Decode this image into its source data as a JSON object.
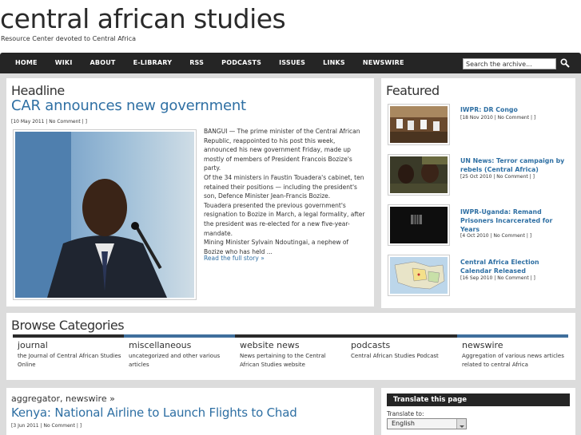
{
  "site": {
    "title": "central african studies",
    "tagline": "Resource Center devoted to Central Africa"
  },
  "nav": {
    "items": [
      "HOME",
      "WIKI",
      "ABOUT",
      "E-LIBRARY",
      "RSS",
      "PODCASTS",
      "ISSUES",
      "LINKS",
      "NEWSWIRE"
    ]
  },
  "search": {
    "placeholder": "Search the archive..."
  },
  "headline": {
    "section_label": "Headline",
    "title": "CAR announces new government",
    "meta": "[10 May 2011 | No Comment | ]",
    "body": [
      "BANGUI — The prime minister of the Central African Republic, reappointed to his post this week, announced his new government Friday, made up mostly of members of President Francois Bozize's party.",
      "Of the 34 ministers in Faustin Touadera's cabinet, ten retained their positions — including the president's son, Defence Minister Jean-Francis Bozize.",
      "Touadera presented the previous government's resignation to Bozize in March, a legal formality, after the president was re-elected for a new five-year-mandate.",
      "Mining Minister Sylvain Ndoutingai, a nephew of Bozize who has held ..."
    ],
    "read_more": "Read the full story »"
  },
  "featured": {
    "section_label": "Featured",
    "items": [
      {
        "title": "IWPR: DR Congo",
        "meta": "[18 Nov 2010 | No Comment | ]"
      },
      {
        "title": "UN News: Terror campaign by rebels (Central Africa)",
        "meta": "[25 Oct 2010 | No Comment | ]"
      },
      {
        "title": "IWPR-Uganda: Remand Prisoners Incarcerated for Years",
        "meta": "[4 Oct 2010 | No Comment | ]"
      },
      {
        "title": "Central Africa Election Calendar Released",
        "meta": "[16 Sep 2010 | No Comment | ]"
      }
    ]
  },
  "browse": {
    "section_label": "Browse Categories",
    "categories": [
      {
        "name": "journal",
        "desc": "the Journal of Central African Studies Online"
      },
      {
        "name": "miscellaneous",
        "desc": "uncategorized and other various articles"
      },
      {
        "name": "website news",
        "desc": "News pertaining to the Central African Studies website"
      },
      {
        "name": "podcasts",
        "desc": "Central African Studies Podcast"
      },
      {
        "name": "newswire",
        "desc": "Aggregation of various news articles related to central Africa"
      }
    ]
  },
  "latest": {
    "category_line": "aggregator, newswire »",
    "title": "Kenya: National Airline to Launch Flights to Chad",
    "meta": "[3 Jun 2011 | No Comment | ]"
  },
  "translate": {
    "header": "Translate this page",
    "label": "Translate to:",
    "selected": "English"
  },
  "colors": {
    "link": "#2e6fa3",
    "nav_bg": "#252525",
    "dark_bar": "#2a2a2a",
    "blue_bar": "#3f6f9c"
  }
}
